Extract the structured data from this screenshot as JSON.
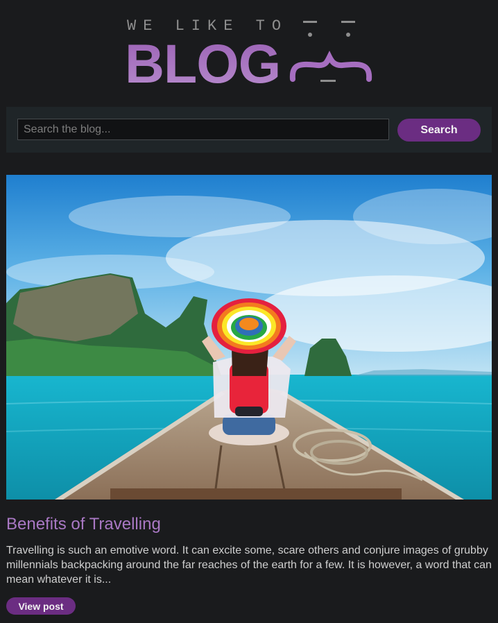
{
  "logo": {
    "top_text": "WE LIKE TO",
    "main_text": "BLOG"
  },
  "search": {
    "placeholder": "Search the blog...",
    "value": "",
    "button_label": "Search"
  },
  "post": {
    "image_subject": "woman in rainbow hat sitting on bow of longtail boat facing islands and turquoise sea",
    "title": "Benefits of Travelling",
    "excerpt": "Travelling is such an emotive word. It can excite some, scare others and conjure images of grubby millennials backpacking around the far reaches of the earth for a few. It is however, a word that can mean whatever it is...",
    "button_label": "View post"
  },
  "colors": {
    "background": "#1a1b1d",
    "accent": "#6b2d82",
    "title": "#a978c4",
    "logo": "#a66ec0"
  }
}
